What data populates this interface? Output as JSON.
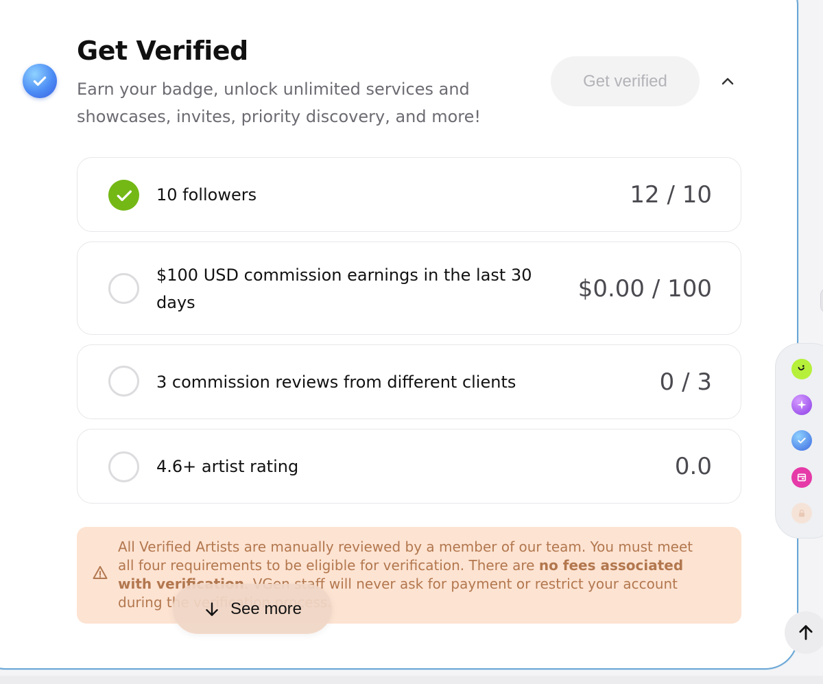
{
  "header": {
    "title": "Get Verified",
    "subtitle": "Earn your badge, unlock unlimited services and showcases, invites, priority discovery, and more!",
    "get_verified_label": "Get verified"
  },
  "requirements": [
    {
      "label": "10 followers",
      "value": "12 / 10",
      "done": true
    },
    {
      "label": "$100 USD commission earnings in the last 30 days",
      "value": "$0.00 / 100",
      "done": false
    },
    {
      "label": "3 commission reviews from different clients",
      "value": "0 / 3",
      "done": false
    },
    {
      "label": "4.6+ artist rating",
      "value": "0.0",
      "done": false
    }
  ],
  "notice": {
    "part1": "All Verified Artists are manually reviewed by a member of our team. You must meet all four requirements to be eligible for verification. There are ",
    "bold": "no fees associated with verification",
    "part2": ". VGen staff will never ask for payment or restrict your account during the verification process."
  },
  "see_more_label": "See more",
  "side_rail": {
    "icons": [
      "vgen-logo-icon",
      "sparkle-icon",
      "verified-check-icon",
      "shop-icon",
      "lock-icon"
    ]
  },
  "colors": {
    "accent_blue": "#4c8cf5",
    "done_green": "#74b816",
    "notice_bg": "#fde3d2",
    "notice_text": "#b2774e"
  }
}
